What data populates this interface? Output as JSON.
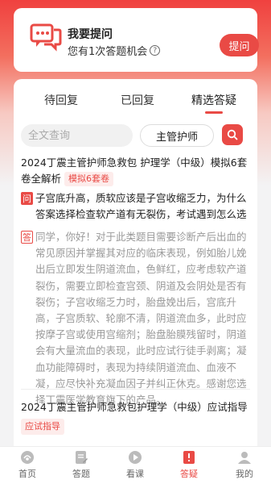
{
  "ask_card": {
    "title": "我要提问",
    "subtitle": "您有1次答题机会",
    "button_label": "提问"
  },
  "tabs": [
    {
      "label": "待回复",
      "active": false
    },
    {
      "label": "已回复",
      "active": false
    },
    {
      "label": "精选答疑",
      "active": true
    }
  ],
  "search": {
    "placeholder": "全文查询",
    "category": "主管护师"
  },
  "questions": [
    {
      "title": "2024丁震主管护师急救包 护理学（中级）模拟6套卷全解析",
      "tag": "模拟6套卷",
      "question_badge": "问",
      "question": "子宫底升高，质软应该是子宫收缩乏力，为什么答案选择检查软产道有无裂伤，考试遇到怎么选",
      "answer_badge": "答",
      "answer": "同学，你好！对于此类题目需要诊断产后出血的常见原因并掌握其对应的临床表现，例如胎儿娩出后立即发生阴道流血，色鲜红，应考虑软产道裂伤，需要立即检查宫颈、阴道及会阴处是否有裂伤；子宫收缩乏力时，胎盘娩出后，宫底升高，子宫质软、轮廓不清，阴道流血多，此时应按摩子宫或使用宫缩剂；胎盘胎膜残留时，阴道会有大量流血的表现，此时应试行徒手剥离；凝血功能障碍时，表现为持续阴道流血、血液不凝，应尽快补充凝血因子并纠正休克。感谢您选择丁震医学教育旗下的产品。"
    },
    {
      "title": "2024丁震主管护师急救包护理学（中级）应试指导",
      "tag": "应试指导"
    }
  ],
  "bottom_nav": [
    {
      "label": "首页",
      "icon": "home-icon",
      "active": false
    },
    {
      "label": "答题",
      "icon": "edit-icon",
      "active": false
    },
    {
      "label": "看课",
      "icon": "play-icon",
      "active": false
    },
    {
      "label": "答疑",
      "icon": "qa-icon",
      "active": true
    },
    {
      "label": "我的",
      "icon": "user-icon",
      "active": false
    }
  ],
  "colors": {
    "accent": "#e94a45",
    "tag_bg": "#fdeceb",
    "answer_text": "#999999"
  }
}
